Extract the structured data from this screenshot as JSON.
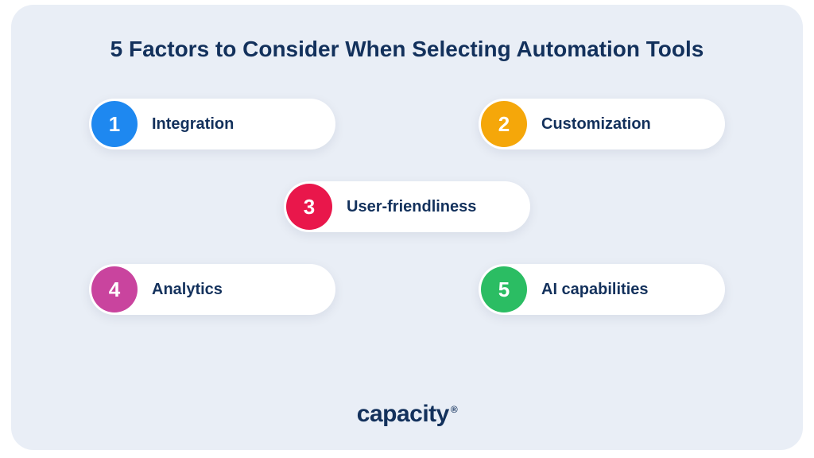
{
  "title": "5 Factors to Consider When Selecting Automation Tools",
  "factors": [
    {
      "num": "1",
      "label": "Integration",
      "color": "#1e88f0"
    },
    {
      "num": "2",
      "label": "Customization",
      "color": "#f5a70a"
    },
    {
      "num": "3",
      "label": "User-friendliness",
      "color": "#e9174b"
    },
    {
      "num": "4",
      "label": "Analytics",
      "color": "#c9449e"
    },
    {
      "num": "5",
      "label": "AI capabilities",
      "color": "#2bbd63"
    }
  ],
  "brand": "capacity",
  "brand_mark": "®"
}
